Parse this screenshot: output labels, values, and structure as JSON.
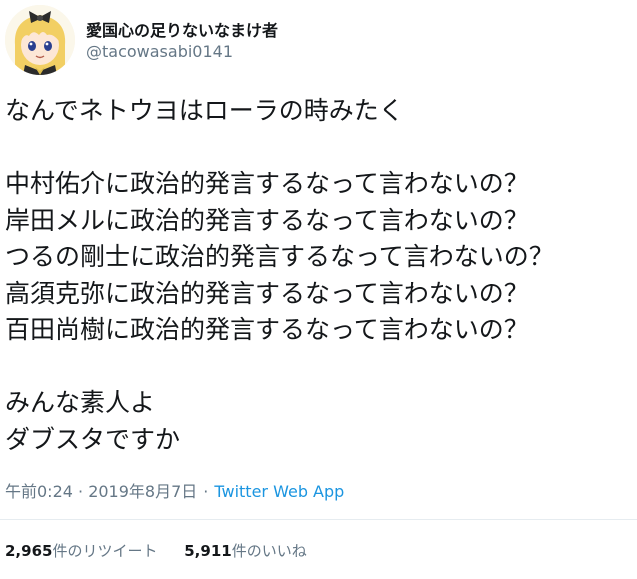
{
  "user": {
    "display_name": "愛国心の足りないなまけ者",
    "handle": "@tacowasabi0141",
    "avatar_icon": "avatar-anime-character-icon"
  },
  "tweet": {
    "lines": [
      "なんでネトウヨはローラの時みたく",
      "",
      "中村佑介に政治的発言するなって言わないの？",
      "岸田メルに政治的発言するなって言わないの？",
      "つるの剛士に政治的発言するなって言わないの？",
      "高須克弥に政治的発言するなって言わないの？",
      "百田尚樹に政治的発言するなって言わないの？",
      "",
      "みんな素人よ",
      "ダブスタですか"
    ]
  },
  "meta": {
    "timestamp": "午前0:24 · 2019年8月7日",
    "separator": "·",
    "source": "Twitter Web App"
  },
  "stats": {
    "retweets_count": "2,965",
    "retweets_label": "件のリツイート",
    "likes_count": "5,911",
    "likes_label": "件のいいね"
  },
  "colors": {
    "text": "#14171a",
    "secondary": "#657786",
    "link": "#1b95e0",
    "divider": "#e6ecf0"
  }
}
